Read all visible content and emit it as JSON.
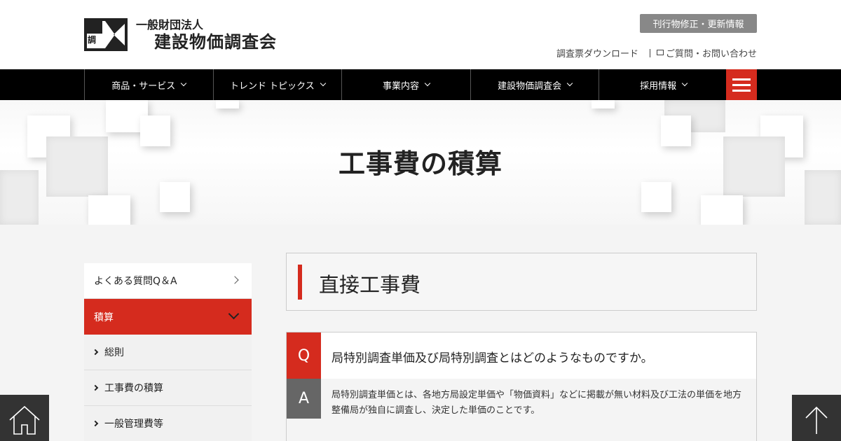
{
  "header": {
    "logo_small": "一般財団法人",
    "logo_big": "建設物価調査会",
    "logo_mark_text": "調",
    "update_button": "刊行物修正・更新情報",
    "download_link": "調査票ダウンロード",
    "contact_link": "ご質問・お問い合わせ"
  },
  "nav": {
    "items": [
      {
        "label": "商品・サービス"
      },
      {
        "label": "トレンド トピックス"
      },
      {
        "label": "事業内容"
      },
      {
        "label": "建設物価調査会"
      },
      {
        "label": "採用情報"
      }
    ],
    "menu_icon": "hamburger-icon"
  },
  "hero": {
    "title": "工事費の積算"
  },
  "sidebar": {
    "items": [
      {
        "label": "よくある質問Q＆A"
      },
      {
        "label": "積算"
      },
      {
        "label": "総則"
      },
      {
        "label": "工事費の積算"
      },
      {
        "label": "一般管理費等"
      }
    ]
  },
  "main": {
    "section_title": "直接工事費",
    "qa": {
      "q_badge": "Q",
      "question": "局特別調査単価及び局特別調査とはどのようなものですか。",
      "a_badge": "A",
      "answer": "局特別調査単価とは、各地方局設定単価や「物価資料」などに掲載が無い材料及び工法の単価を地方整備局が独自に調査し、決定した単価のことです。"
    }
  },
  "floating": {
    "home_icon": "home-icon",
    "top_icon": "arrow-up-icon"
  },
  "colors": {
    "accent": "#d52b1e",
    "nav_bg": "#000000",
    "button_gray": "#888888"
  }
}
